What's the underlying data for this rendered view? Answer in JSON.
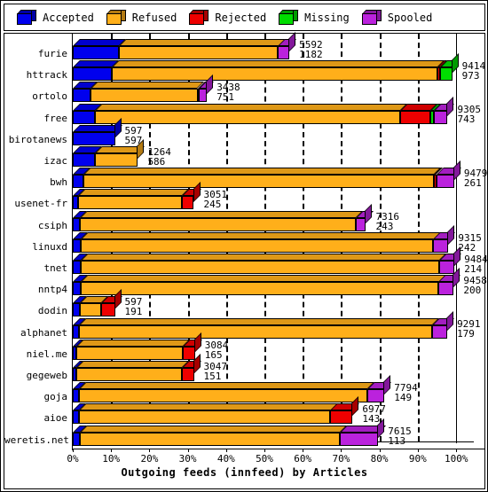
{
  "legend": {
    "items": [
      {
        "label": "Accepted",
        "color": "#0000ee",
        "icon": "cube-icon"
      },
      {
        "label": "Refused",
        "color": "#ffaf1a",
        "icon": "cube-icon"
      },
      {
        "label": "Rejected",
        "color": "#ee0000",
        "icon": "cube-icon"
      },
      {
        "label": "Missing",
        "color": "#00dd00",
        "icon": "cube-icon"
      },
      {
        "label": "Spooled",
        "color": "#bb22dd",
        "icon": "cube-icon"
      }
    ]
  },
  "axis": {
    "x_title": "Outgoing feeds (innfeed) by Articles",
    "x_ticks": [
      "0%",
      "10%",
      "20%",
      "30%",
      "40%",
      "50%",
      "60%",
      "70%",
      "80%",
      "90%",
      "100%"
    ]
  },
  "chart_data": {
    "type": "bar",
    "orientation": "horizontal",
    "stacked": true,
    "title": "Outgoing feeds (innfeed) by Articles",
    "xlabel": "Outgoing feeds (innfeed) by Articles",
    "ylabel": "",
    "xlim": [
      0,
      100
    ],
    "xtick_labels": [
      "0%",
      "10%",
      "20%",
      "30%",
      "40%",
      "50%",
      "60%",
      "70%",
      "80%",
      "90%",
      "100%"
    ],
    "grid": true,
    "legend_position": "top",
    "series_names": [
      "Accepted",
      "Refused",
      "Rejected",
      "Missing",
      "Spooled"
    ],
    "series_colors": [
      "#0000ee",
      "#ffaf1a",
      "#ee0000",
      "#00dd00",
      "#bb22dd"
    ],
    "categories": [
      "furie",
      "httrack",
      "ortolo",
      "free",
      "birotanews",
      "izac",
      "bwh",
      "usenet-fr",
      "csiph",
      "linuxd",
      "tnet",
      "nntp4",
      "dodin",
      "alphanet",
      "niel.me",
      "gegeweb",
      "goja",
      "aioe",
      "weretis.net"
    ],
    "annotations": [
      {
        "category": "furie",
        "total": "5592",
        "secondary": "1182"
      },
      {
        "category": "httrack",
        "total": "9414",
        "secondary": "973"
      },
      {
        "category": "ortolo",
        "total": "3438",
        "secondary": "751"
      },
      {
        "category": "free",
        "total": "9305",
        "secondary": "743"
      },
      {
        "category": "birotanews",
        "total": "597",
        "secondary": "597"
      },
      {
        "category": "izac",
        "total": "1264",
        "secondary": "586"
      },
      {
        "category": "bwh",
        "total": "9479",
        "secondary": "261"
      },
      {
        "category": "usenet-fr",
        "total": "3051",
        "secondary": "245"
      },
      {
        "category": "csiph",
        "total": "7316",
        "secondary": "243"
      },
      {
        "category": "linuxd",
        "total": "9315",
        "secondary": "242"
      },
      {
        "category": "tnet",
        "total": "9484",
        "secondary": "214"
      },
      {
        "category": "nntp4",
        "total": "9458",
        "secondary": "200"
      },
      {
        "category": "dodin",
        "total": "597",
        "secondary": "191"
      },
      {
        "category": "alphanet",
        "total": "9291",
        "secondary": "179"
      },
      {
        "category": "niel.me",
        "total": "3084",
        "secondary": "165"
      },
      {
        "category": "gegeweb",
        "total": "3047",
        "secondary": "151"
      },
      {
        "category": "goja",
        "total": "7794",
        "secondary": "149"
      },
      {
        "category": "aioe",
        "total": "6977",
        "secondary": "143"
      },
      {
        "category": "weretis.net",
        "total": "7615",
        "secondary": "113"
      }
    ],
    "rows": [
      {
        "label": "furie",
        "total": "5592",
        "secondary": "1182",
        "bar_pct": 56.5,
        "segments": [
          {
            "name": "Accepted",
            "color": "#0000ee",
            "pct": 21.1
          },
          {
            "name": "Refused",
            "color": "#ffaf1a",
            "pct": 73.6
          },
          {
            "name": "Spooled",
            "color": "#bb22dd",
            "pct": 5.3
          }
        ]
      },
      {
        "label": "httrack",
        "total": "9414",
        "secondary": "973",
        "bar_pct": 99.0,
        "segments": [
          {
            "name": "Accepted",
            "color": "#0000ee",
            "pct": 10.3
          },
          {
            "name": "Refused",
            "color": "#ffaf1a",
            "pct": 85.8
          },
          {
            "name": "Rejected",
            "color": "#ee0000",
            "pct": 0.8
          },
          {
            "name": "Missing",
            "color": "#00dd00",
            "pct": 3.1
          }
        ]
      },
      {
        "label": "ortolo",
        "total": "3438",
        "secondary": "751",
        "bar_pct": 35.0,
        "segments": [
          {
            "name": "Accepted",
            "color": "#0000ee",
            "pct": 13.5
          },
          {
            "name": "Refused",
            "color": "#ffaf1a",
            "pct": 79.5
          },
          {
            "name": "Rejected",
            "color": "#ee0000",
            "pct": 0.8
          },
          {
            "name": "Spooled",
            "color": "#bb22dd",
            "pct": 6.2
          }
        ]
      },
      {
        "label": "free",
        "total": "9305",
        "secondary": "743",
        "bar_pct": 97.8,
        "segments": [
          {
            "name": "Accepted",
            "color": "#0000ee",
            "pct": 6.0
          },
          {
            "name": "Refused",
            "color": "#ffaf1a",
            "pct": 81.4
          },
          {
            "name": "Rejected",
            "color": "#ee0000",
            "pct": 8.0
          },
          {
            "name": "Missing",
            "color": "#00dd00",
            "pct": 1.0
          },
          {
            "name": "Spooled",
            "color": "#bb22dd",
            "pct": 3.6
          }
        ]
      },
      {
        "label": "birotanews",
        "total": "597",
        "secondary": "597",
        "bar_pct": 11.0,
        "segments": [
          {
            "name": "Accepted",
            "color": "#0000ee",
            "pct": 100
          }
        ]
      },
      {
        "label": "izac",
        "total": "1264",
        "secondary": "586",
        "bar_pct": 17.0,
        "segments": [
          {
            "name": "Accepted",
            "color": "#0000ee",
            "pct": 34.5
          },
          {
            "name": "Refused",
            "color": "#ffaf1a",
            "pct": 65.5
          }
        ]
      },
      {
        "label": "bwh",
        "total": "9479",
        "secondary": "261",
        "bar_pct": 99.5,
        "segments": [
          {
            "name": "Accepted",
            "color": "#0000ee",
            "pct": 2.8
          },
          {
            "name": "Refused",
            "color": "#ffaf1a",
            "pct": 92.0
          },
          {
            "name": "Rejected",
            "color": "#ee0000",
            "pct": 0.5
          },
          {
            "name": "Spooled",
            "color": "#bb22dd",
            "pct": 4.7
          }
        ]
      },
      {
        "label": "usenet-fr",
        "total": "3051",
        "secondary": "245",
        "bar_pct": 31.6,
        "segments": [
          {
            "name": "Accepted",
            "color": "#0000ee",
            "pct": 4.1
          },
          {
            "name": "Refused",
            "color": "#ffaf1a",
            "pct": 86.0
          },
          {
            "name": "Rejected",
            "color": "#ee0000",
            "pct": 9.9
          }
        ]
      },
      {
        "label": "csiph",
        "total": "7316",
        "secondary": "243",
        "bar_pct": 76.5,
        "segments": [
          {
            "name": "Accepted",
            "color": "#0000ee",
            "pct": 2.4
          },
          {
            "name": "Refused",
            "color": "#ffaf1a",
            "pct": 94.0
          },
          {
            "name": "Spooled",
            "color": "#bb22dd",
            "pct": 3.6
          }
        ]
      },
      {
        "label": "linuxd",
        "total": "9315",
        "secondary": "242",
        "bar_pct": 98.0,
        "segments": [
          {
            "name": "Accepted",
            "color": "#0000ee",
            "pct": 2.1
          },
          {
            "name": "Refused",
            "color": "#ffaf1a",
            "pct": 93.9
          },
          {
            "name": "Spooled",
            "color": "#bb22dd",
            "pct": 4.0
          }
        ]
      },
      {
        "label": "tnet",
        "total": "9484",
        "secondary": "214",
        "bar_pct": 99.6,
        "segments": [
          {
            "name": "Accepted",
            "color": "#0000ee",
            "pct": 2.1
          },
          {
            "name": "Refused",
            "color": "#ffaf1a",
            "pct": 94.0
          },
          {
            "name": "Spooled",
            "color": "#bb22dd",
            "pct": 3.9
          }
        ]
      },
      {
        "label": "nntp4",
        "total": "9458",
        "secondary": "200",
        "bar_pct": 99.4,
        "segments": [
          {
            "name": "Accepted",
            "color": "#0000ee",
            "pct": 2.0
          },
          {
            "name": "Refused",
            "color": "#ffaf1a",
            "pct": 94.0
          },
          {
            "name": "Spooled",
            "color": "#bb22dd",
            "pct": 4.0
          }
        ]
      },
      {
        "label": "dodin",
        "total": "597",
        "secondary": "191",
        "bar_pct": 11.0,
        "segments": [
          {
            "name": "Accepted",
            "color": "#0000ee",
            "pct": 17.0
          },
          {
            "name": "Refused",
            "color": "#ffaf1a",
            "pct": 50.0
          },
          {
            "name": "Rejected",
            "color": "#ee0000",
            "pct": 33.0
          }
        ]
      },
      {
        "label": "alphanet",
        "total": "9291",
        "secondary": "179",
        "bar_pct": 97.7,
        "segments": [
          {
            "name": "Accepted",
            "color": "#0000ee",
            "pct": 1.6
          },
          {
            "name": "Refused",
            "color": "#ffaf1a",
            "pct": 94.4
          },
          {
            "name": "Spooled",
            "color": "#bb22dd",
            "pct": 4.0
          }
        ]
      },
      {
        "label": "niel.me",
        "total": "3084",
        "secondary": "165",
        "bar_pct": 31.9,
        "segments": [
          {
            "name": "Accepted",
            "color": "#0000ee",
            "pct": 3.0
          },
          {
            "name": "Refused",
            "color": "#ffaf1a",
            "pct": 87.0
          },
          {
            "name": "Rejected",
            "color": "#ee0000",
            "pct": 10.0
          }
        ]
      },
      {
        "label": "gegeweb",
        "total": "3047",
        "secondary": "151",
        "bar_pct": 31.6,
        "segments": [
          {
            "name": "Accepted",
            "color": "#0000ee",
            "pct": 3.0
          },
          {
            "name": "Refused",
            "color": "#ffaf1a",
            "pct": 87.0
          },
          {
            "name": "Rejected",
            "color": "#ee0000",
            "pct": 10.0
          }
        ]
      },
      {
        "label": "goja",
        "total": "7794",
        "secondary": "149",
        "bar_pct": 81.3,
        "segments": [
          {
            "name": "Accepted",
            "color": "#0000ee",
            "pct": 1.9
          },
          {
            "name": "Refused",
            "color": "#ffaf1a",
            "pct": 92.6
          },
          {
            "name": "Spooled",
            "color": "#bb22dd",
            "pct": 5.5
          }
        ]
      },
      {
        "label": "aioe",
        "total": "6977",
        "secondary": "143",
        "bar_pct": 73.0,
        "segments": [
          {
            "name": "Accepted",
            "color": "#0000ee",
            "pct": 2.1
          },
          {
            "name": "Refused",
            "color": "#ffaf1a",
            "pct": 90.0
          },
          {
            "name": "Rejected",
            "color": "#ee0000",
            "pct": 7.9
          }
        ]
      },
      {
        "label": "weretis.net",
        "total": "7615",
        "secondary": "113",
        "bar_pct": 79.7,
        "segments": [
          {
            "name": "Accepted",
            "color": "#0000ee",
            "pct": 2.3
          },
          {
            "name": "Refused",
            "color": "#ffaf1a",
            "pct": 85.0
          },
          {
            "name": "Spooled",
            "color": "#bb22dd",
            "pct": 12.7
          }
        ]
      }
    ]
  }
}
